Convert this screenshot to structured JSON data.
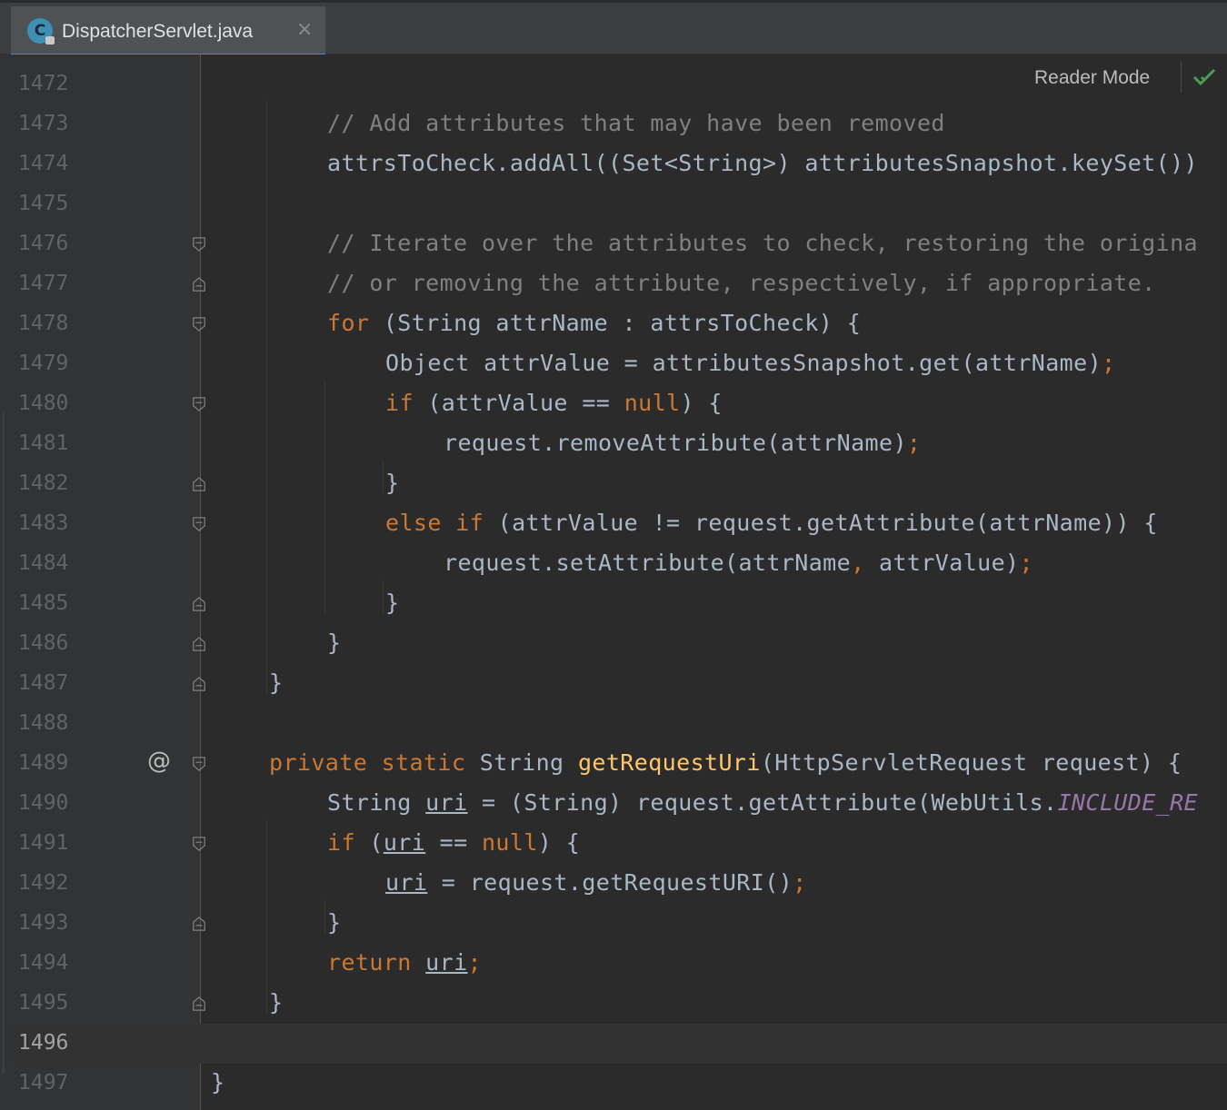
{
  "tab": {
    "title": "DispatcherServlet.java",
    "icon_letter": "C",
    "close_glyph": "×"
  },
  "toolbar": {
    "reader_mode": "Reader Mode"
  },
  "colors": {
    "keyword": "#cc7832",
    "comment": "#808080",
    "method": "#ffc66d",
    "static_field": "#9876aa",
    "text": "#a9b7c6",
    "accent": "#4a88c7"
  },
  "gutter": {
    "annotation_glyph": "@"
  },
  "lines": [
    {
      "n": "1472",
      "indent": 0,
      "tokens": []
    },
    {
      "n": "1473",
      "indent": 2,
      "tokens": [
        [
          "cm",
          "// Add attributes that may have been removed"
        ]
      ]
    },
    {
      "n": "1474",
      "indent": 2,
      "tokens": [
        [
          "tx",
          "attrsToCheck.addAll((Set<String>) attributesSnapshot.keySet())"
        ]
      ]
    },
    {
      "n": "1475",
      "indent": 0,
      "tokens": []
    },
    {
      "n": "1476",
      "indent": 2,
      "tokens": [
        [
          "cm",
          "// Iterate over the attributes to check, restoring the origina"
        ]
      ]
    },
    {
      "n": "1477",
      "indent": 2,
      "tokens": [
        [
          "cm",
          "// or removing the attribute, respectively, if appropriate."
        ]
      ]
    },
    {
      "n": "1478",
      "indent": 2,
      "tokens": [
        [
          "kw",
          "for "
        ],
        [
          "tx",
          "(String attrName : attrsToCheck) {"
        ]
      ]
    },
    {
      "n": "1479",
      "indent": 3,
      "tokens": [
        [
          "tx",
          "Object attrValue = attributesSnapshot.get(attrName)"
        ],
        [
          "kw",
          ";"
        ]
      ]
    },
    {
      "n": "1480",
      "indent": 3,
      "tokens": [
        [
          "kw",
          "if "
        ],
        [
          "tx",
          "(attrValue == "
        ],
        [
          "kw",
          "null"
        ],
        [
          "tx",
          ") {"
        ]
      ]
    },
    {
      "n": "1481",
      "indent": 4,
      "tokens": [
        [
          "tx",
          "request.removeAttribute(attrName)"
        ],
        [
          "kw",
          ";"
        ]
      ]
    },
    {
      "n": "1482",
      "indent": 3,
      "tokens": [
        [
          "tx",
          "}"
        ]
      ]
    },
    {
      "n": "1483",
      "indent": 3,
      "tokens": [
        [
          "kw",
          "else if "
        ],
        [
          "tx",
          "(attrValue != request.getAttribute(attrName)) {"
        ]
      ]
    },
    {
      "n": "1484",
      "indent": 4,
      "tokens": [
        [
          "tx",
          "request.setAttribute(attrName"
        ],
        [
          "kw",
          ", "
        ],
        [
          "tx",
          "attrValue)"
        ],
        [
          "kw",
          ";"
        ]
      ]
    },
    {
      "n": "1485",
      "indent": 3,
      "tokens": [
        [
          "tx",
          "}"
        ]
      ]
    },
    {
      "n": "1486",
      "indent": 2,
      "tokens": [
        [
          "tx",
          "}"
        ]
      ]
    },
    {
      "n": "1487",
      "indent": 1,
      "tokens": [
        [
          "tx",
          "}"
        ]
      ]
    },
    {
      "n": "1488",
      "indent": 0,
      "tokens": []
    },
    {
      "n": "1489",
      "indent": 1,
      "tokens": [
        [
          "kw",
          "private static "
        ],
        [
          "tx",
          "String "
        ],
        [
          "fn",
          "getRequestUri"
        ],
        [
          "tx",
          "(HttpServletRequest request) {"
        ]
      ]
    },
    {
      "n": "1490",
      "indent": 2,
      "tokens": [
        [
          "tx",
          "String "
        ],
        [
          "ul",
          "uri"
        ],
        [
          "tx",
          " = (String) request.getAttribute(WebUtils."
        ],
        [
          "st",
          "INCLUDE_RE"
        ]
      ]
    },
    {
      "n": "1491",
      "indent": 2,
      "tokens": [
        [
          "kw",
          "if "
        ],
        [
          "tx",
          "("
        ],
        [
          "ul",
          "uri"
        ],
        [
          "tx",
          " == "
        ],
        [
          "kw",
          "null"
        ],
        [
          "tx",
          ") {"
        ]
      ]
    },
    {
      "n": "1492",
      "indent": 3,
      "tokens": [
        [
          "ul",
          "uri"
        ],
        [
          "tx",
          " = request.getRequestURI()"
        ],
        [
          "kw",
          ";"
        ]
      ]
    },
    {
      "n": "1493",
      "indent": 2,
      "tokens": [
        [
          "tx",
          "}"
        ]
      ]
    },
    {
      "n": "1494",
      "indent": 2,
      "tokens": [
        [
          "kw",
          "return "
        ],
        [
          "ul",
          "uri"
        ],
        [
          "kw",
          ";"
        ]
      ]
    },
    {
      "n": "1495",
      "indent": 1,
      "tokens": [
        [
          "tx",
          "}"
        ]
      ]
    },
    {
      "n": "1496",
      "indent": 0,
      "tokens": []
    },
    {
      "n": "1497",
      "indent": 0,
      "tokens": [
        [
          "tx",
          "}"
        ]
      ]
    }
  ]
}
